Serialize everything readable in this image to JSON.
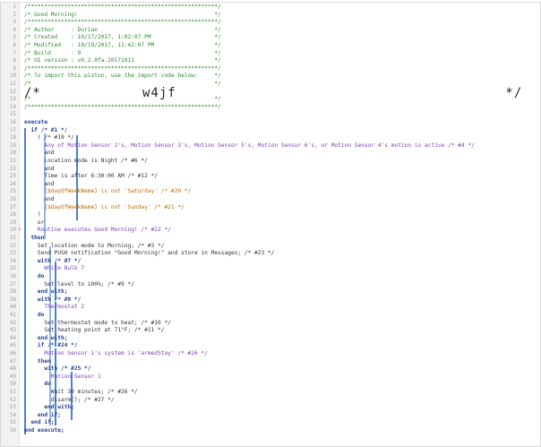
{
  "lines": [
    "/*********************************************************/",
    "/* Good Morning!                                         */",
    "/*********************************************************/",
    "/* Author     : Dorian                                   */",
    "/* Created    : 10/17/2017, 1:02:07 PM                   */",
    "/* Modified   : 10/19/2017, 11:42:07 PM                  */",
    "/* Build      : 9                                        */",
    "/* UI version : v0.2.0fa.20171011                        */",
    "/*********************************************************/",
    "/* To import this piston, use the import code below:     */",
    "/*                                                       */",
    "/*            w4jf                                       */",
    "/*                                                       */",
    "/*********************************************************/",
    "",
    "execute",
    "  if /* #1 */",
    "    ( /* #19 */",
    "      Any of Motion Sensor 2's, Motion Sensor 3's, Motion Sensor 5's, Motion Sensor 6's, or Motion Sensor 4's motion is active /* #4 */",
    "      and",
    "      Location mode is Night /* #6 */",
    "      and",
    "      Time is after 6:30:00 AM /* #12 */",
    "      and",
    "      {$dayOfWeekName} is not 'Saturday' /* #20 */",
    "      and",
    "      {$dayOfWeekName} is not 'Sunday' /* #21 */",
    "    )",
    "    or",
    "    Routine executes Good Morning! /* #22 */",
    "  then",
    "    Set location mode to Morning; /* #3 */",
    "    Send PUSH notification \"Good Morning!\" and store in Messages; /* #23 */",
    "    with /* #7 */",
    "      White Bulb 7",
    "    do",
    "      Set level to 100%; /* #9 */",
    "    end with;",
    "    with /* #8 */",
    "      Thermostat 2",
    "    do",
    "      Set thermostat mode to heat; /* #10 */",
    "      Set heating point at 71°F; /* #11 */",
    "    end with;",
    "    if /* #24 */",
    "      Motion Sensor 1's system is 'armedStay' /* #26 */",
    "    then",
    "      with /* #25 */",
    "        Motion Sensor 1",
    "      do",
    "        Wait 30 minutes; /* #26 */",
    "        disarm(); /* #27 */",
    "      end with;",
    "    end if;",
    "  end if;",
    "end execute;"
  ]
}
